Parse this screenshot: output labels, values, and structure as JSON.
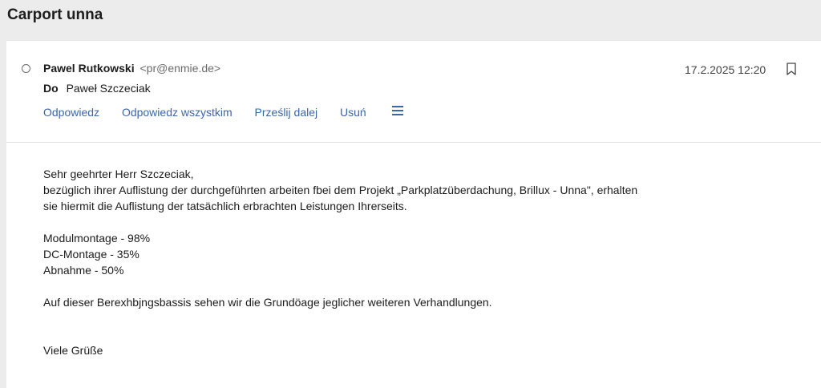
{
  "subject": "Carport unna",
  "sender": {
    "name": "Pawel Rutkowski",
    "email": "<pr@enmie.de>"
  },
  "recipient": {
    "label": "Do",
    "name": "Paweł Szczeciak"
  },
  "date": "17.2.2025 12:20",
  "actions": {
    "reply": "Odpowiedz",
    "reply_all": "Odpowiedz wszystkim",
    "forward": "Prześlij dalej",
    "delete": "Usuń"
  },
  "icons": {
    "status": "radio-circle-icon",
    "flag": "bookmark-icon",
    "more": "hamburger-menu-icon"
  },
  "colors": {
    "link": "#3b66a8",
    "background": "#ececec"
  },
  "body": {
    "greeting": "Sehr geehrter Herr Szczeciak,",
    "line1": "bezüglich ihrer Auflistung der durchgeführten arbeiten fbei dem Projekt „Parkplatzüberdachung, Brillux - Unna\", erhalten",
    "line2": "sie hiermit die Auflistung der tatsächlich erbrachten Leistungen Ihrerseits.",
    "items": [
      "Modulmontage - 98%",
      "DC-Montage - 35%",
      "Abnahme - 50%"
    ],
    "closing_line": "Auf dieser Berexhbjngsbassis sehen wir die Grundöage jeglicher weiteren Verhandlungen.",
    "signoff": "Viele Grüße"
  }
}
